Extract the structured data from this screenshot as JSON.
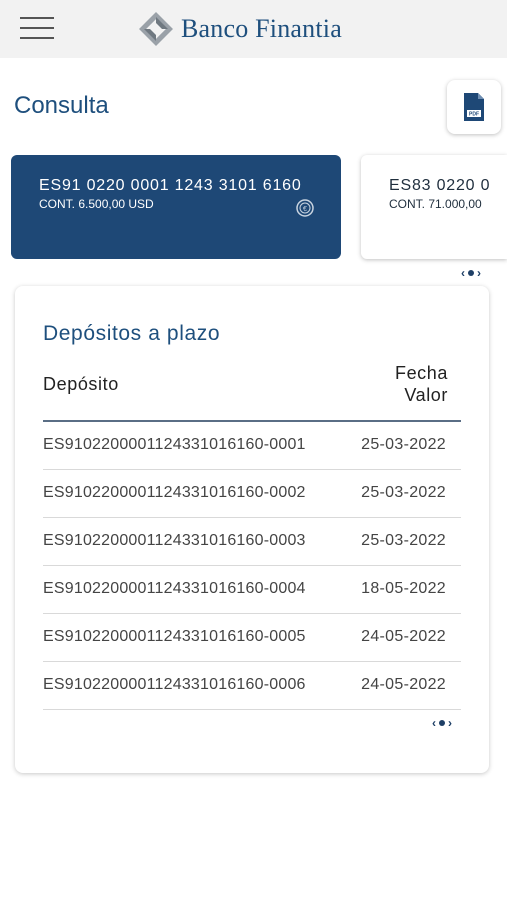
{
  "header": {
    "menu_icon": "hamburger-menu-icon",
    "logo_icon": "banco-finantia-logo-mark",
    "brand": "Banco Finantia"
  },
  "page": {
    "title": "Consulta",
    "pdf_icon": "pdf-file-icon",
    "pdf_label": "PDF"
  },
  "accounts": [
    {
      "iban": "ES91 0220 0001 1243 3101 6160",
      "cont": "CONT. 6.500,00 USD",
      "icon": "euro-coin-icon",
      "selected": true
    },
    {
      "iban": "ES83 0220 0",
      "cont": "CONT. 71.000,00",
      "selected": false
    }
  ],
  "deposits": {
    "title": "Depósitos a plazo",
    "col_deposit": "Depósito",
    "col_fecha_1": "Fecha",
    "col_fecha_2": "Valor",
    "rows": [
      {
        "deposito": "ES9102200001124331016160-0001",
        "fecha": "25-03-2022"
      },
      {
        "deposito": "ES9102200001124331016160-0002",
        "fecha": "25-03-2022"
      },
      {
        "deposito": "ES9102200001124331016160-0003",
        "fecha": "25-03-2022"
      },
      {
        "deposito": "ES9102200001124331016160-0004",
        "fecha": "18-05-2022"
      },
      {
        "deposito": "ES9102200001124331016160-0005",
        "fecha": "24-05-2022"
      },
      {
        "deposito": "ES9102200001124331016160-0006",
        "fecha": "24-05-2022"
      }
    ]
  },
  "pager": {
    "prev": "‹",
    "next": "›"
  },
  "colors": {
    "primary": "#1e4876",
    "brand_text": "#1e4f7d",
    "header_bg": "#f2f2f2"
  }
}
